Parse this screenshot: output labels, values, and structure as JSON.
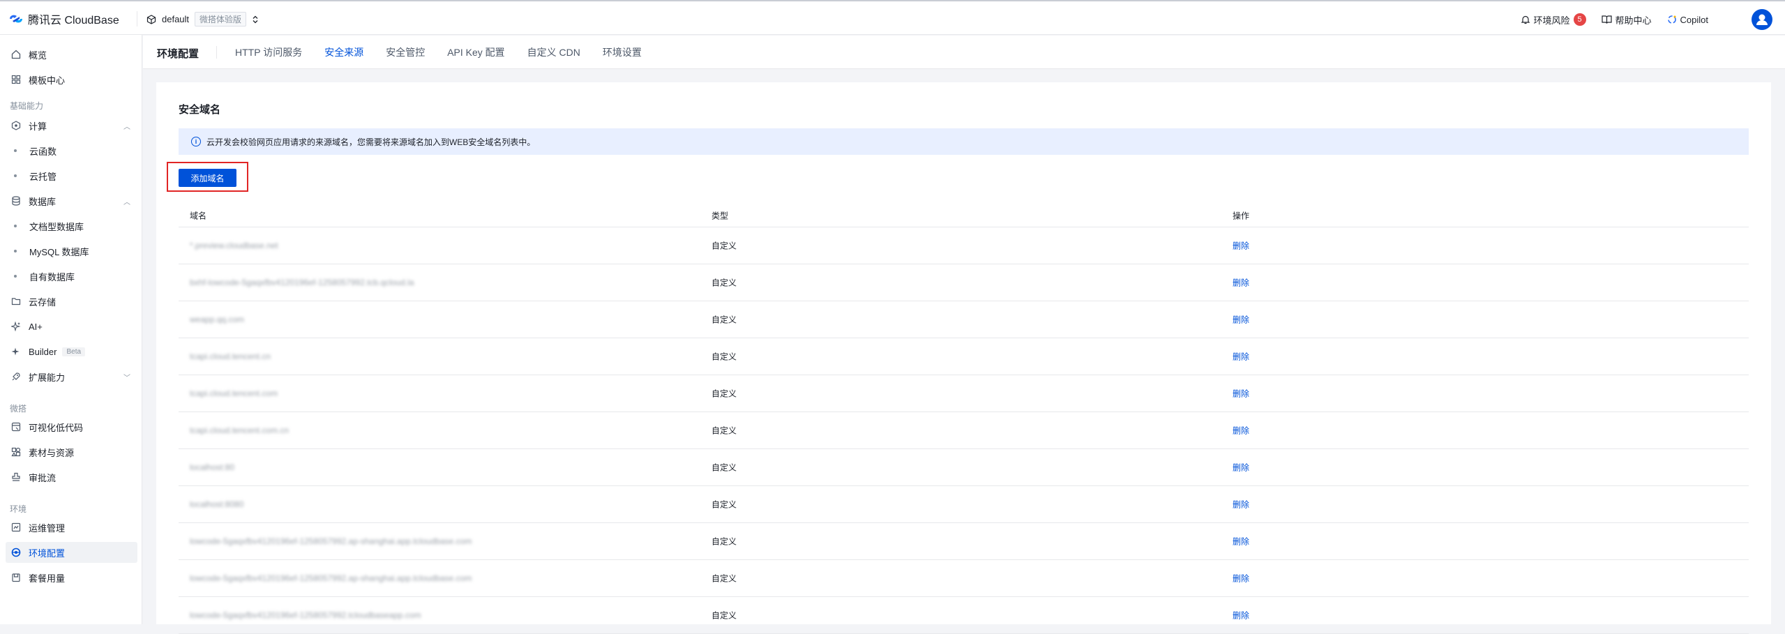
{
  "topbar": {
    "brand": "腾讯云 CloudBase",
    "env_name": "default",
    "env_tag": "微搭体验版",
    "risk_label": "环境风险",
    "risk_count": "5",
    "help_label": "帮助中心",
    "copilot_label": "Copilot"
  },
  "sidebar": {
    "overview": "概览",
    "templates": "模板中心",
    "group_basic": "基础能力",
    "compute": "计算",
    "functions": "云函数",
    "hosting": "云托管",
    "database": "数据库",
    "doc_db": "文档型数据库",
    "mysql_db": "MySQL 数据库",
    "own_db": "自有数据库",
    "storage": "云存储",
    "ai": "AI+",
    "builder": "Builder",
    "builder_tag": "Beta",
    "extensions": "扩展能力",
    "group_weda": "微搭",
    "lowcode": "可视化低代码",
    "assets": "素材与资源",
    "approval": "审批流",
    "group_env": "环境",
    "ops": "运维管理",
    "env_config": "环境配置",
    "usage": "套餐用量"
  },
  "header": {
    "title": "环境配置",
    "tabs": [
      "HTTP 访问服务",
      "安全来源",
      "安全管控",
      "API Key 配置",
      "自定义 CDN",
      "环境设置"
    ]
  },
  "main": {
    "section_title": "安全域名",
    "notice": "云开发会校验网页应用请求的来源域名，您需要将来源域名加入到WEB安全域名列表中。",
    "add_button": "添加域名",
    "columns": [
      "域名",
      "类型",
      "操作"
    ],
    "rows": [
      {
        "domain": "*.preview.cloudbase.net",
        "type": "自定义",
        "action": "删除"
      },
      {
        "domain": "bxhf-lowcode-5gaqxfbv4120196ef-1258057992.tcb.qcloud.la",
        "type": "自定义",
        "action": "删除"
      },
      {
        "domain": "weapp.qq.com",
        "type": "自定义",
        "action": "删除"
      },
      {
        "domain": "tcapi.cloud.tencent.cn",
        "type": "自定义",
        "action": "删除"
      },
      {
        "domain": "tcapi.cloud.tencent.com",
        "type": "自定义",
        "action": "删除"
      },
      {
        "domain": "tcapi.cloud.tencent.com.cn",
        "type": "自定义",
        "action": "删除"
      },
      {
        "domain": "localhost:80",
        "type": "自定义",
        "action": "删除"
      },
      {
        "domain": "localhost:8080",
        "type": "自定义",
        "action": "删除"
      },
      {
        "domain": "lowcode-5gaqxfbv4120196ef-1258057992.ap-shanghai.app.tcloudbase.com",
        "type": "自定义",
        "action": "删除"
      },
      {
        "domain": "lowcode-5gaqxfbv4120196ef-1258057992.ap-shanghai.app.tcloudbase.com",
        "type": "自定义",
        "action": "删除"
      },
      {
        "domain": "lowcode-5gaqxfbv4120196ef-1258057992.tcloudbaseapp.com",
        "type": "自定义",
        "action": "删除"
      }
    ]
  }
}
